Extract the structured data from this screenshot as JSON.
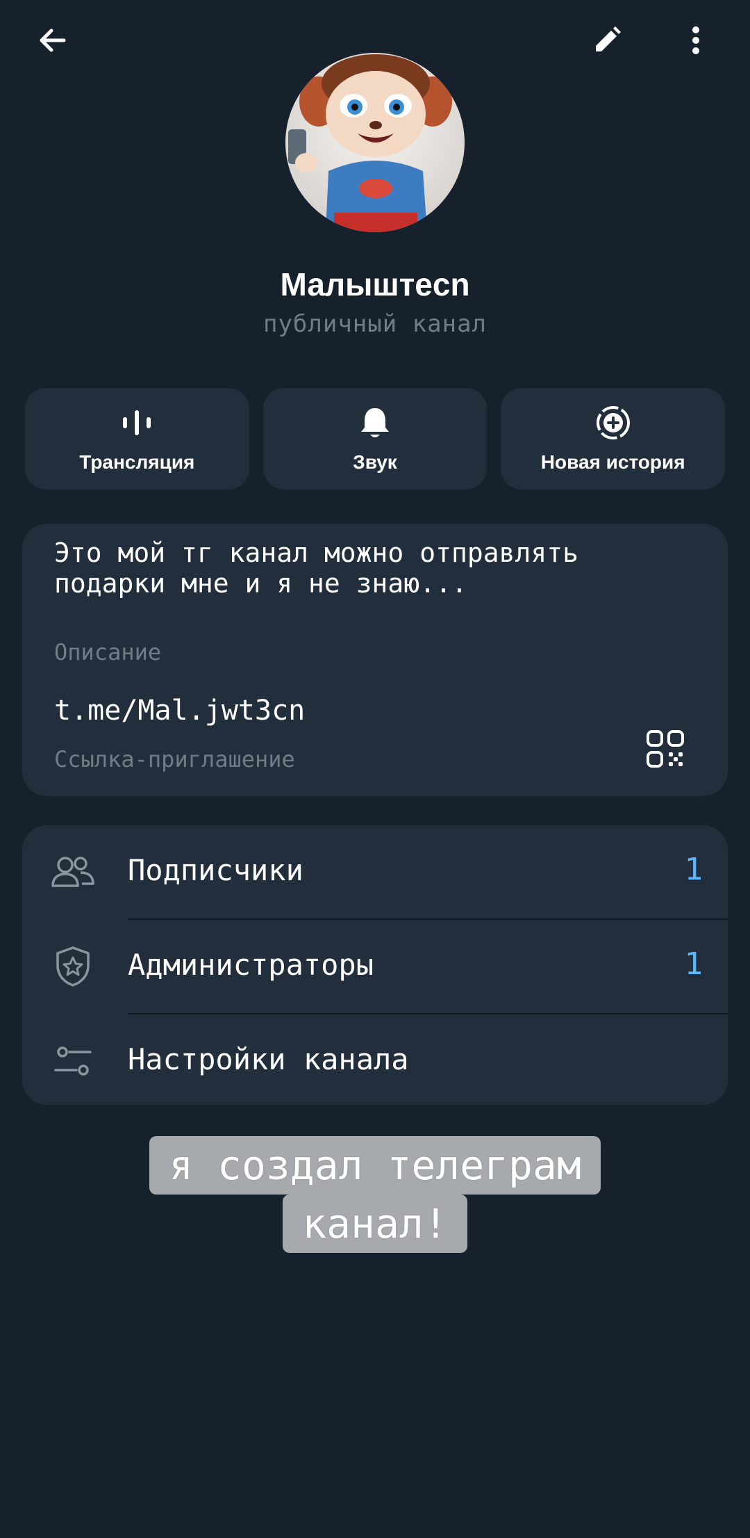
{
  "header": {
    "back_icon": "arrow-left-icon",
    "edit_icon": "pencil-icon",
    "more_icon": "more-vertical-icon"
  },
  "profile": {
    "name": "Малыштеcn",
    "type": "публичный канал"
  },
  "actions": [
    {
      "label": "Трансляция",
      "icon": "live-stream-icon"
    },
    {
      "label": "Звук",
      "icon": "bell-icon"
    },
    {
      "label": "Новая история",
      "icon": "new-story-icon"
    }
  ],
  "info": {
    "description": "Это мой тг канал можно отправлять подарки мне и я не знаю...",
    "description_label": "Описание",
    "link": "t.me/Mal.jwt3cn",
    "link_label": "Ссылка-приглашение"
  },
  "list": [
    {
      "label": "Подписчики",
      "count": "1",
      "icon": "people-icon"
    },
    {
      "label": "Администраторы",
      "count": "1",
      "icon": "shield-star-icon"
    },
    {
      "label": "Настройки канала",
      "count": "",
      "icon": "sliders-icon"
    }
  ],
  "caption": {
    "line1": "я создал телеграм",
    "line2": "канал!"
  },
  "colors": {
    "background": "#17212b",
    "card": "#232e3c",
    "accent": "#5eb5f7",
    "secondary_text": "#707c88"
  }
}
